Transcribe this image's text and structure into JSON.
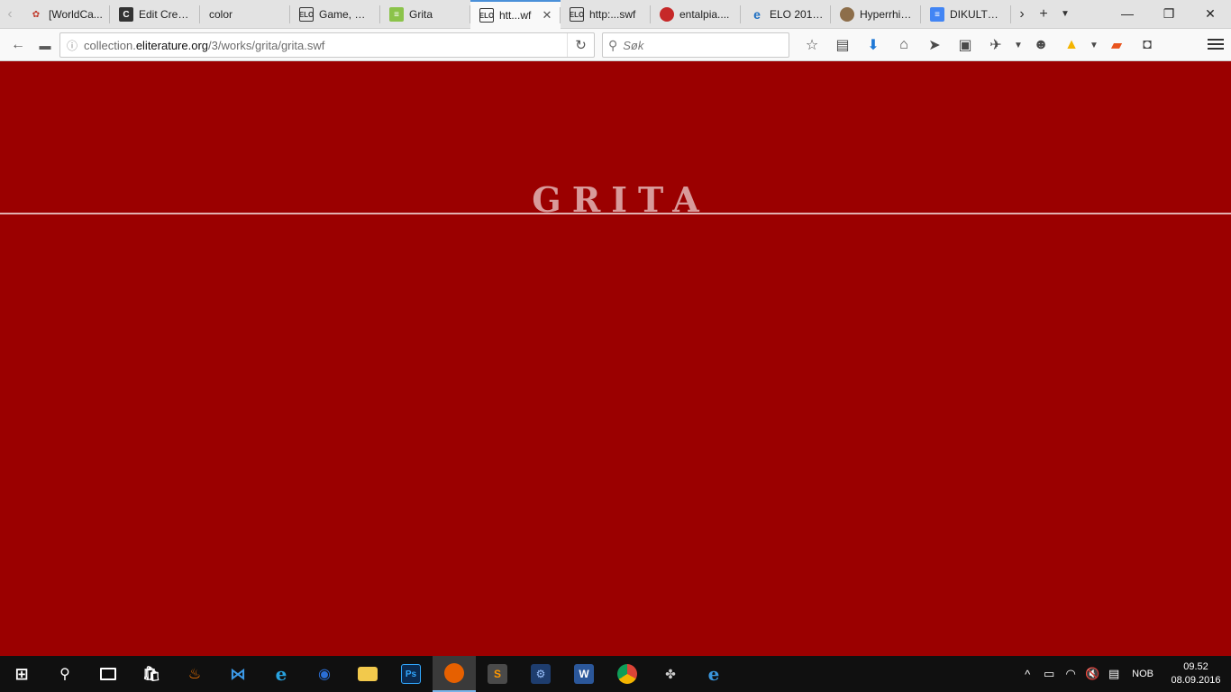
{
  "browser": {
    "tabs": [
      {
        "title": "[WorldCa...",
        "icon": "worldcat-icon",
        "active": false
      },
      {
        "title": "Edit Creat...",
        "icon": "edit-page-icon",
        "active": false
      },
      {
        "title": "color",
        "icon": "",
        "active": false
      },
      {
        "title": "Game, Ga...",
        "icon": "elo-icon",
        "active": false
      },
      {
        "title": "Grita",
        "icon": "green-doc-icon",
        "active": false
      },
      {
        "title": "htt...wf",
        "icon": "elo-icon",
        "active": true
      },
      {
        "title": "http:...swf",
        "icon": "elo-icon",
        "active": false
      },
      {
        "title": "entalpia....",
        "icon": "red-circle-icon",
        "active": false
      },
      {
        "title": "ELO 2017 ...",
        "icon": "edge-icon",
        "active": false
      },
      {
        "title": "Hyperrhiz...",
        "icon": "brown-circle-icon",
        "active": false
      },
      {
        "title": "DIKULT20...",
        "icon": "google-docs-icon",
        "active": false
      }
    ],
    "url_prefix": "collection.",
    "url_domain": "eliterature.org",
    "url_path": "/3/works/grita/grita.swf",
    "search_placeholder": "Søk"
  },
  "page": {
    "title": "GRITA",
    "background_color": "#9b0000",
    "title_color": "#d89a9a"
  },
  "taskbar": {
    "language": "NOB",
    "time": "09.52",
    "date": "08.09.2016"
  }
}
